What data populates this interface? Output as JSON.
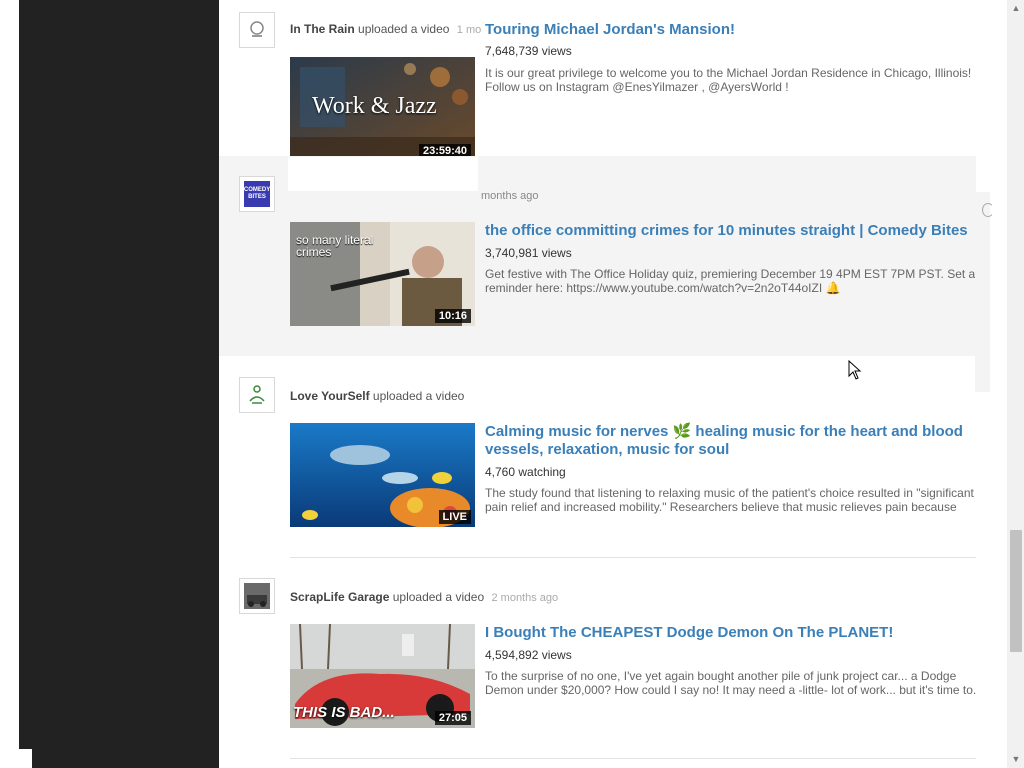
{
  "feed": [
    {
      "channel": "In The Rain",
      "action": "uploaded a video",
      "age": "1 mo",
      "title": "Touring Michael Jordan's Mansion!",
      "views": "7,648,739 views",
      "description": "It is our great privilege to welcome you to the Michael Jordan Residence in Chicago, Illinois! Follow us on Instagram @EnesYilmazer , @AyersWorld !",
      "thumb_text": "Work & Jazz",
      "duration": "23:59:40"
    },
    {
      "channel": "",
      "action": "",
      "age": "months ago",
      "title": "the office committing crimes for 10 minutes straight | Comedy Bites",
      "views": "3,740,981 views",
      "description": "Get festive with The Office Holiday quiz, premiering December 19 4PM EST 7PM PST. Set a reminder here: https://www.youtube.com/watch?v=2n2oT44oIZI 🔔",
      "thumb_text": "so many literal crimes",
      "duration": "10:16",
      "avatar_text": "COMEDY BITES"
    },
    {
      "channel": "Love YourSelf",
      "action": "uploaded a video",
      "age": "",
      "title": "Calming music for nerves 🌿 healing music for the heart and blood vessels, relaxation, music for soul",
      "views": "4,760 watching",
      "description": "The study found that listening to relaxing music of the patient's choice resulted in \"significant pain relief and increased mobility.\" Researchers believe that music relieves pain because",
      "duration": "LIVE"
    },
    {
      "channel": "ScrapLife Garage",
      "action": "uploaded a video",
      "age": "2 months ago",
      "title": "I Bought The CHEAPEST Dodge Demon On The PLANET!",
      "views": "4,594,892 views",
      "description": "To the surprise of no one, I've yet again bought another pile of junk project car... a Dodge Demon under $20,000? How could I say no! It may need a -little- lot of work... but it's time to.",
      "thumb_text": "THIS IS BAD...",
      "duration": "27:05"
    }
  ],
  "colors": {
    "title_link": "#3a7fb8",
    "sidebar": "#222222",
    "shaded_row": "#f4f4f4"
  },
  "icons": {
    "cursor": "arrow-cursor-icon",
    "scroll_up": "scroll-up-arrow-icon",
    "scroll_down": "scroll-down-arrow-icon"
  }
}
